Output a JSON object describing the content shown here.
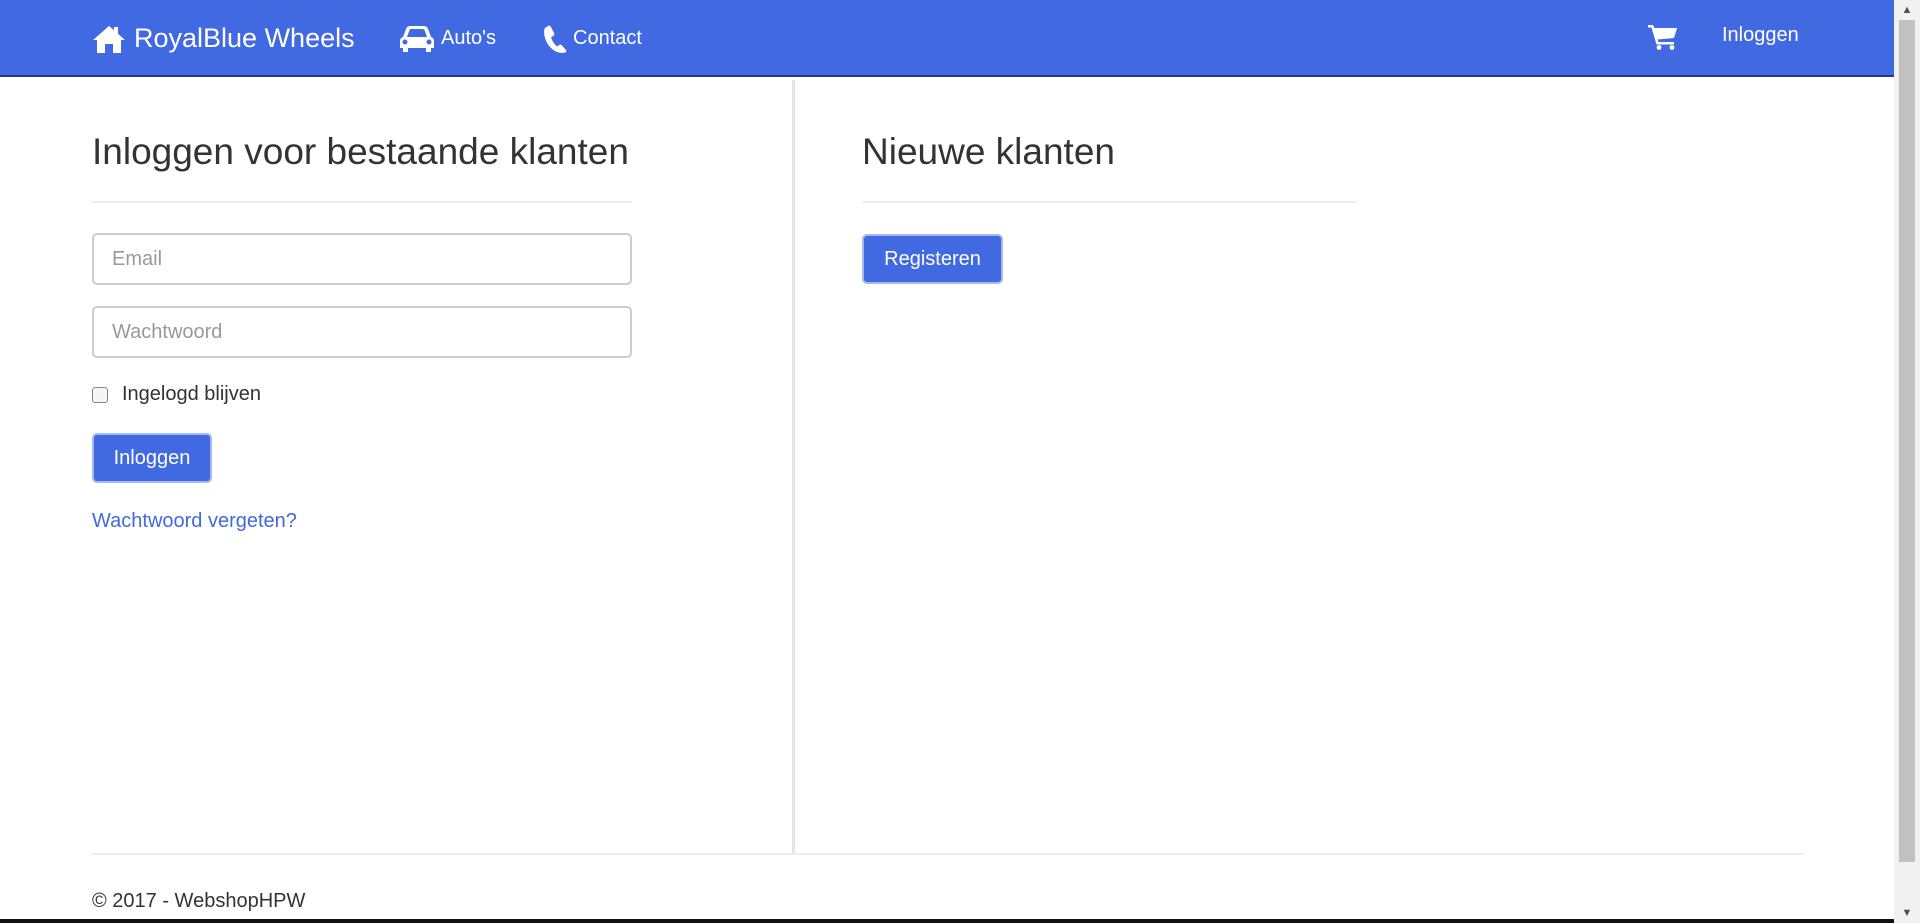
{
  "navbar": {
    "brand": "RoyalBlue Wheels",
    "brand_icon": "home-icon",
    "autos": "Auto's",
    "autos_icon": "car-icon",
    "contact": "Contact",
    "contact_icon": "phone-icon",
    "cart_icon": "shopping-cart-icon",
    "login": "Inloggen",
    "background_color": "#4169e1"
  },
  "login_section": {
    "title": "Inloggen voor bestaande klanten",
    "email_placeholder": "Email",
    "password_placeholder": "Wachtwoord",
    "remember_label": "Ingelogd blijven",
    "remember_checked": false,
    "submit_label": "Inloggen",
    "forgot_link": "Wachtwoord vergeten?"
  },
  "register_section": {
    "title": "Nieuwe klanten",
    "register_label": "Registeren"
  },
  "footer": {
    "text": "© 2017 - WebshopHPW"
  }
}
